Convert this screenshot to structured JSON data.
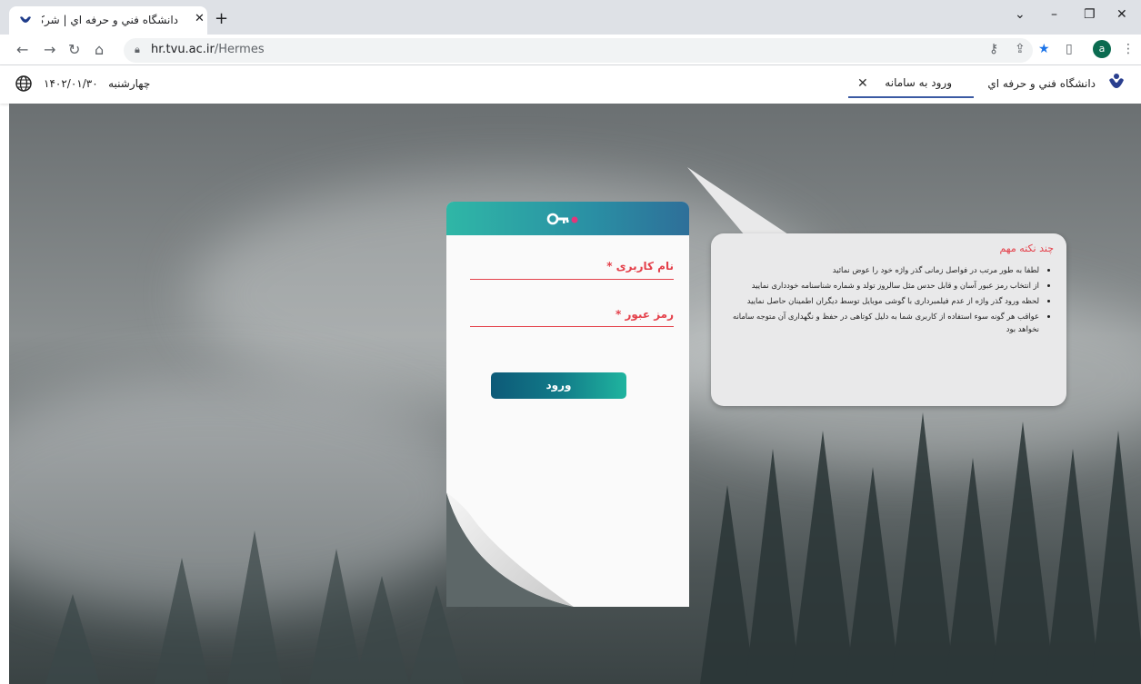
{
  "browser": {
    "tab_title": "دانشگاه فني و حرفه اي | شركت سا",
    "url_host": "hr.tvu.ac.ir",
    "url_path": "/Hermes",
    "profile_initial": "a"
  },
  "header": {
    "day_name": "چهارشنبه",
    "date": "۱۴۰۲/۰۱/۳۰",
    "org_name": "دانشگاه فني و حرفه اي",
    "login_tab_label": "ورود به سامانه"
  },
  "login": {
    "username_label": "نام کاربری *",
    "password_label": "رمز عبور *",
    "submit_label": "ورود"
  },
  "tips": {
    "title": "چند نکته مهم",
    "items": [
      "لطفا به طور مرتب در فواصل زمانی گذر واژه خود را عوض نمائید",
      "از انتخاب رمز عبور آسان و قابل حدس مثل سالروز تولد و شماره شناسنامه خودداری نمایید",
      "لحظه ورود گذر واژه از عدم فیلمبرداری با گوشی موبایل توسط دیگران اطمینان حاصل نمایید",
      "عواقب هر گونه سوء استفاده از کاربری شما به دلیل کوتاهی در حفظ و نگهداری آن متوجه سامانه نخواهد بود"
    ]
  },
  "colors": {
    "accent_red": "#e4414b",
    "header_teal": "#2fb7a6",
    "button_dark": "#0d5a78"
  }
}
